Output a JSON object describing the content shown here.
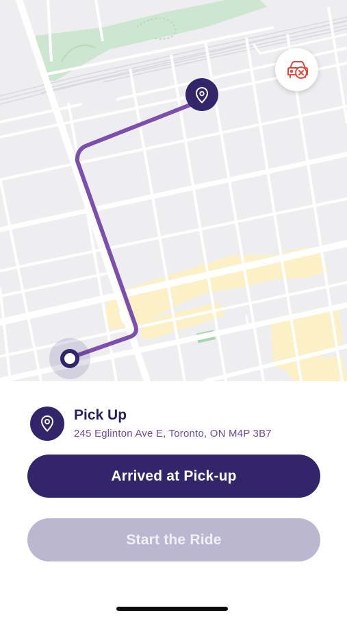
{
  "map": {
    "route_color": "#7b4fab",
    "park_color": "#cde6cf",
    "commercial_color": "#fbf0c6"
  },
  "cancel_button": {
    "icon": "car-cancel-icon",
    "icon_color": "#e0483b"
  },
  "pickup": {
    "icon": "location-pin-icon",
    "title": "Pick Up",
    "address": "245 Eglinton Ave E, Toronto, ON M4P 3B7"
  },
  "actions": {
    "arrived_label": "Arrived at Pick-up",
    "start_label": "Start the Ride",
    "start_enabled": false
  },
  "colors": {
    "primary": "#33256a",
    "disabled": "#bcb7d1",
    "address_text": "#6a4aa8"
  }
}
